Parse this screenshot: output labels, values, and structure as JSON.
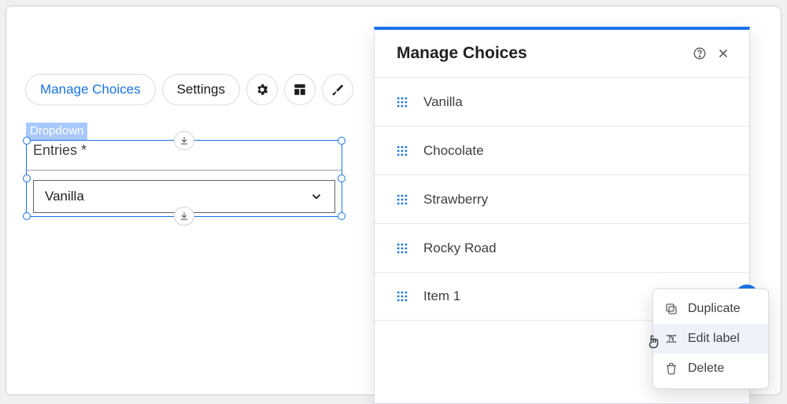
{
  "toolbar": {
    "manage_choices": "Manage Choices",
    "settings": "Settings"
  },
  "canvas": {
    "component_tag": "Dropdown",
    "field_label": "Entries *",
    "selected_value": "Vanilla"
  },
  "panel": {
    "title": "Manage Choices",
    "choices": [
      {
        "label": "Vanilla"
      },
      {
        "label": "Chocolate"
      },
      {
        "label": "Strawberry"
      },
      {
        "label": "Rocky Road"
      },
      {
        "label": "Item 1"
      }
    ]
  },
  "context_menu": {
    "items": [
      {
        "label": "Duplicate"
      },
      {
        "label": "Edit label"
      },
      {
        "label": "Delete"
      }
    ]
  }
}
